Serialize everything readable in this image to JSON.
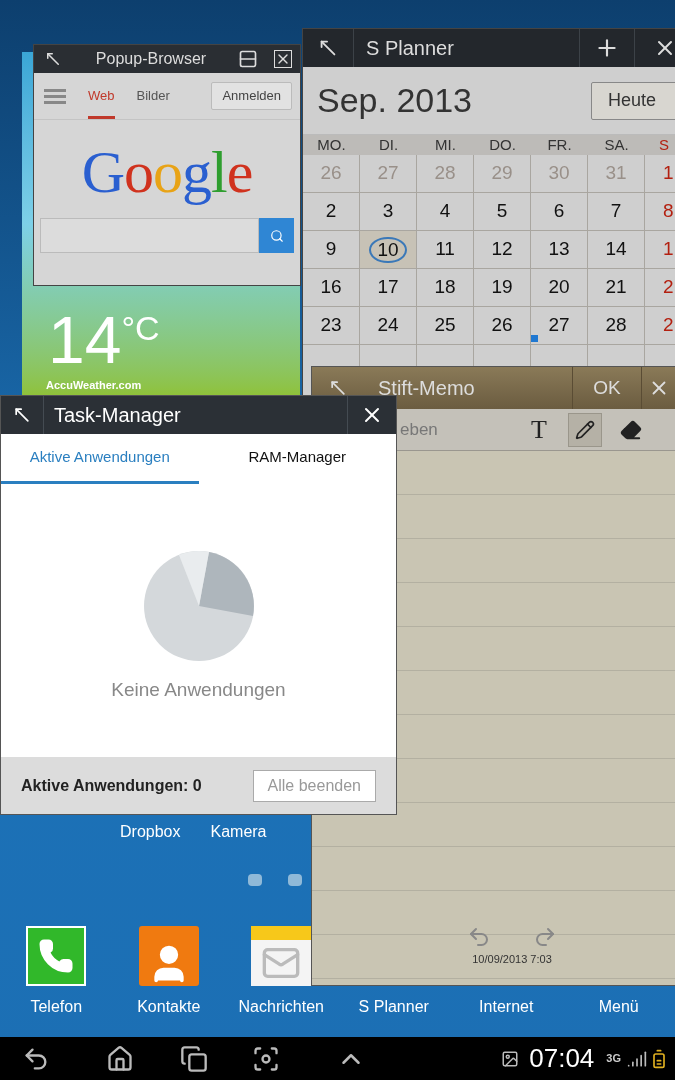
{
  "weather_widget": {
    "temperature": "14",
    "unit": "°C",
    "source": "AccuWeather.com"
  },
  "popup_browser": {
    "title": "Popup-Browser",
    "tabs": [
      {
        "label": "Web",
        "selected": true
      },
      {
        "label": "Bilder",
        "selected": false
      }
    ],
    "sign_in": "Anmelden",
    "logo": "Google"
  },
  "calendar": {
    "title": "S Planner",
    "month": "Sep. 2013",
    "today_button": "Heute",
    "weekdays": [
      "MO.",
      "DI.",
      "MI.",
      "DO.",
      "FR.",
      "SA.",
      "S"
    ],
    "weeks": [
      [
        {
          "text": "26",
          "kind": "other"
        },
        {
          "text": "27",
          "kind": "other"
        },
        {
          "text": "28",
          "kind": "other"
        },
        {
          "text": "29",
          "kind": "other"
        },
        {
          "text": "30",
          "kind": "other"
        },
        {
          "text": "31",
          "kind": "other"
        },
        {
          "text": "1",
          "kind": "sunday"
        }
      ],
      [
        {
          "text": "2",
          "kind": "normal"
        },
        {
          "text": "3",
          "kind": "normal"
        },
        {
          "text": "4",
          "kind": "normal"
        },
        {
          "text": "5",
          "kind": "normal"
        },
        {
          "text": "6",
          "kind": "normal"
        },
        {
          "text": "7",
          "kind": "normal"
        },
        {
          "text": "8",
          "kind": "sunday"
        }
      ],
      [
        {
          "text": "9",
          "kind": "normal"
        },
        {
          "text": "10",
          "kind": "today"
        },
        {
          "text": "11",
          "kind": "normal"
        },
        {
          "text": "12",
          "kind": "normal"
        },
        {
          "text": "13",
          "kind": "normal"
        },
        {
          "text": "14",
          "kind": "normal"
        },
        {
          "text": "1",
          "kind": "sunday"
        }
      ],
      [
        {
          "text": "16",
          "kind": "normal"
        },
        {
          "text": "17",
          "kind": "normal"
        },
        {
          "text": "18",
          "kind": "normal"
        },
        {
          "text": "19",
          "kind": "normal"
        },
        {
          "text": "20",
          "kind": "normal"
        },
        {
          "text": "21",
          "kind": "normal"
        },
        {
          "text": "2",
          "kind": "sunday"
        }
      ],
      [
        {
          "text": "23",
          "kind": "normal"
        },
        {
          "text": "24",
          "kind": "normal"
        },
        {
          "text": "25",
          "kind": "normal"
        },
        {
          "text": "26",
          "kind": "normal"
        },
        {
          "text": "27",
          "kind": "event"
        },
        {
          "text": "28",
          "kind": "normal"
        },
        {
          "text": "2",
          "kind": "sunday"
        }
      ]
    ]
  },
  "memo": {
    "title": "Stift-Memo",
    "ok": "OK",
    "hint": "eben",
    "tools": [
      {
        "kind": "text",
        "label": "T",
        "selected": false
      },
      {
        "kind": "pen",
        "selected": true
      },
      {
        "kind": "eraser",
        "selected": false
      }
    ],
    "timestamp": "10/09/2013 7:03"
  },
  "task_manager": {
    "title": "Task-Manager",
    "tabs": [
      {
        "label": "Aktive Anwendungen",
        "selected": true
      },
      {
        "label": "RAM-Manager",
        "selected": false
      }
    ],
    "empty_text": "Keine Anwendungen",
    "footer": "Aktive Anwendungen: 0",
    "end_all": {
      "label": "Alle beenden",
      "disabled": true
    }
  },
  "home_shortcuts": [
    "Dropbox",
    "Kamera"
  ],
  "dock": [
    {
      "label": "Telefon",
      "kind": "phone"
    },
    {
      "label": "Kontakte",
      "kind": "contacts"
    },
    {
      "label": "Nachrichten",
      "kind": "messages"
    },
    {
      "label": "S Planner",
      "kind": "planner"
    },
    {
      "label": "Internet",
      "kind": "internet"
    },
    {
      "label": "Menü",
      "kind": "menu"
    }
  ],
  "status_bar": {
    "time": "07:04",
    "network": "3G"
  }
}
